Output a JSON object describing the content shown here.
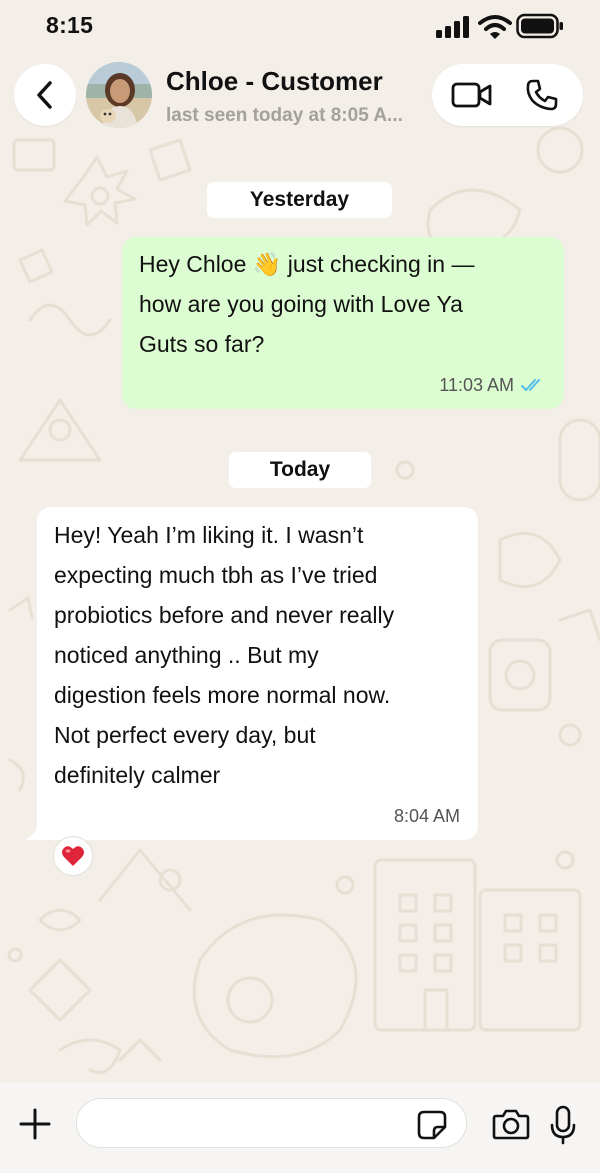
{
  "status_bar": {
    "time": "8:15",
    "icons": [
      "signal-icon",
      "wifi-icon",
      "battery-icon"
    ]
  },
  "header": {
    "contact_name": "Chloe - Customer",
    "last_seen": "last seen today at 8:05 A...",
    "icons": [
      "back-chevron-icon",
      "avatar",
      "video-camera-icon",
      "phone-icon"
    ]
  },
  "conversation": {
    "sections": [
      {
        "date_label": "Yesterday",
        "messages": [
          {
            "direction": "outgoing",
            "text": "Hey Chloe 👋 just checking in —\nhow are you going with Love Ya\nGuts so far?",
            "time": "11:03 AM",
            "status": "read"
          }
        ]
      },
      {
        "date_label": "Today",
        "messages": [
          {
            "direction": "incoming",
            "text": "Hey! Yeah I’m liking it.  I wasn’t\nexpecting much tbh as I’ve tried\nprobiotics before and never really\nnoticed anything .. But my\ndigestion feels more normal now.\nNot perfect every day, but\ndefinitely calmer",
            "time": "8:04 AM",
            "reaction": "❤️"
          }
        ]
      }
    ]
  },
  "composer": {
    "input_value": "",
    "icons": [
      "plus-icon",
      "sticker-icon",
      "camera-icon",
      "microphone-icon"
    ]
  },
  "colors": {
    "background": "#f3efe8",
    "outgoing_bubble": "#dcfcd1",
    "incoming_bubble": "#ffffff",
    "read_receipt": "#53bdeb",
    "muted_text": "#a4a09a"
  }
}
